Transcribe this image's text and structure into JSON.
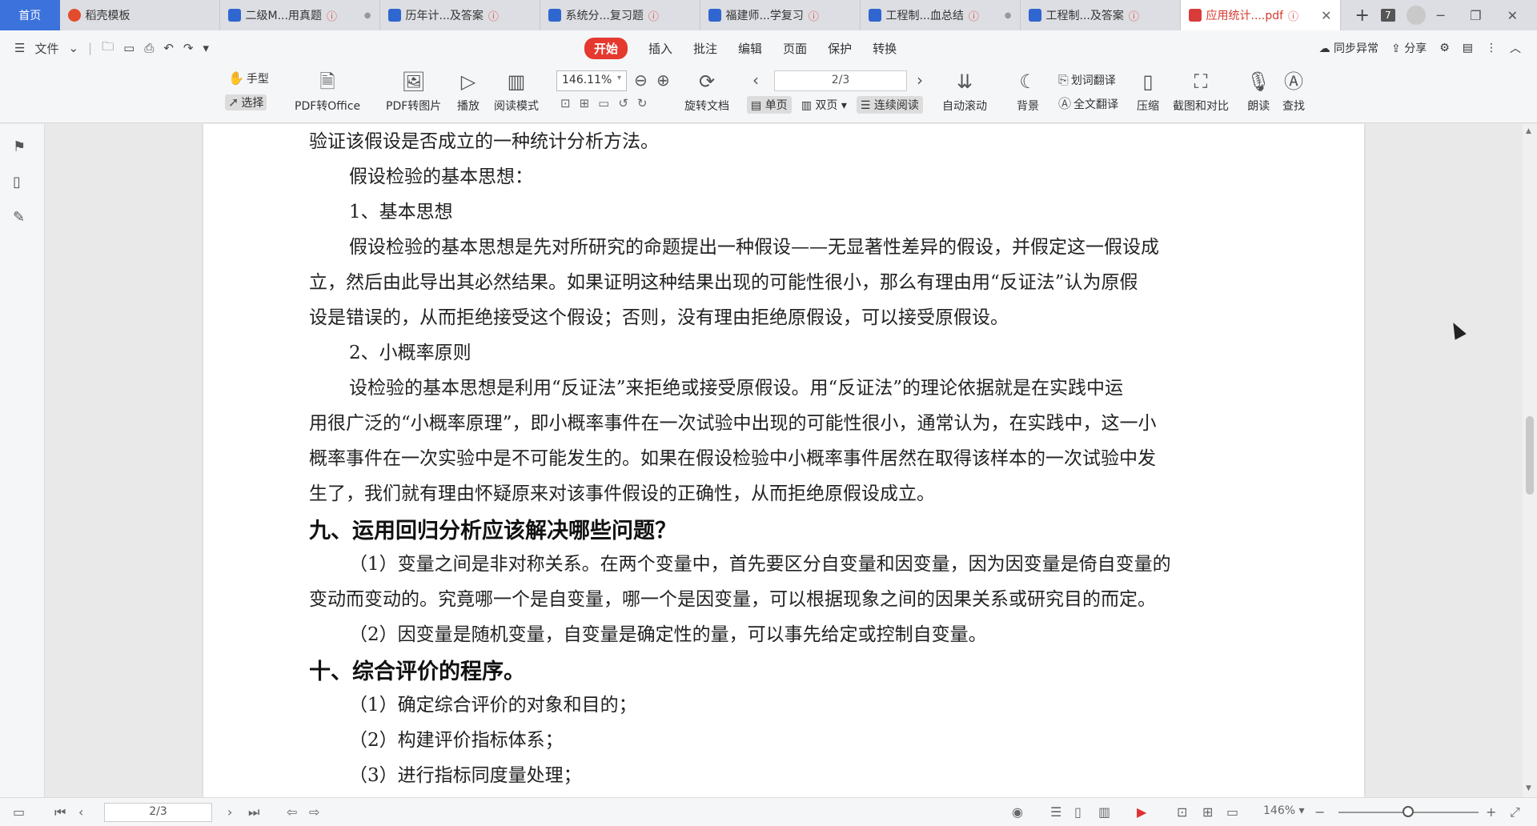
{
  "tabs": {
    "home": "首页",
    "items": [
      {
        "label": "稻壳模板",
        "type": "d"
      },
      {
        "label": "二级M...用真题",
        "type": "w",
        "warn": true,
        "dot": true
      },
      {
        "label": "历年计...及答案",
        "type": "w",
        "warn": true
      },
      {
        "label": "系统分...复习题",
        "type": "w",
        "warn": true
      },
      {
        "label": "福建师...学复习",
        "type": "w",
        "warn": true
      },
      {
        "label": "工程制...血总结",
        "type": "w",
        "warn": true,
        "dot": true
      },
      {
        "label": "工程制...及答案",
        "type": "w",
        "warn": true
      },
      {
        "label": "应用统计....pdf",
        "type": "p",
        "warn": true,
        "active": true
      }
    ],
    "tab_count": "7"
  },
  "menu": {
    "file": "文件",
    "items": [
      "开始",
      "插入",
      "批注",
      "编辑",
      "页面",
      "保护",
      "转换"
    ],
    "sync": "同步异常",
    "share": "分享"
  },
  "toolbar": {
    "hand": "手型",
    "select": "选择",
    "pdf_office": "PDF转Office",
    "pdf_image": "PDF转图片",
    "play": "播放",
    "read_mode": "阅读模式",
    "zoom_value": "146.11%",
    "rotate": "旋转文档",
    "page_value": "2/3",
    "single": "单页",
    "double": "双页",
    "continuous": "连续阅读",
    "autoscroll": "自动滚动",
    "background": "背景",
    "word_translate": "划词翻译",
    "full_translate": "全文翻译",
    "compress": "压缩",
    "screenshot": "截图和对比",
    "read_aloud": "朗读",
    "find": "查找"
  },
  "document": {
    "lines": [
      {
        "text": "验证该假设是否成立的一种统计分析方法。",
        "style": "p"
      },
      {
        "text": "假设检验的基本思想：",
        "style": "in"
      },
      {
        "text": "1、基本思想",
        "style": "in"
      },
      {
        "text": "假设检验的基本思想是先对所研究的命题提出一种假设——无显著性差异的假设，并假定这一假设成",
        "style": "in"
      },
      {
        "text": "立，然后由此导出其必然结果。如果证明这种结果出现的可能性很小，那么有理由用“反证法”认为原假",
        "style": "p"
      },
      {
        "text": "设是错误的，从而拒绝接受这个假设；否则，没有理由拒绝原假设，可以接受原假设。",
        "style": "p"
      },
      {
        "text": "2、小概率原则",
        "style": "in"
      },
      {
        "text": "设检验的基本思想是利用“反证法”来拒绝或接受原假设。用“反证法”的理论依据就是在实践中运",
        "style": "in"
      },
      {
        "text": "用很广泛的“小概率原理”，即小概率事件在一次试验中出现的可能性很小，通常认为，在实践中，这一小",
        "style": "p"
      },
      {
        "text": "概率事件在一次实验中是不可能发生的。如果在假设检验中小概率事件居然在取得该样本的一次试验中发",
        "style": "p"
      },
      {
        "text": "生了，我们就有理由怀疑原来对该事件假设的正确性，从而拒绝原假设成立。",
        "style": "p"
      },
      {
        "text": "九、运用回归分析应该解决哪些问题？",
        "style": "h"
      },
      {
        "text": "（1）变量之间是非对称关系。在两个变量中，首先要区分自变量和因变量，因为因变量是倚自变量的",
        "style": "in"
      },
      {
        "text": "变动而变动的。究竟哪一个是自变量，哪一个是因变量，可以根据现象之间的因果关系或研究目的而定。",
        "style": "p"
      },
      {
        "text": "（2）因变量是随机变量，自变量是确定性的量，可以事先给定或控制自变量。",
        "style": "in"
      },
      {
        "text": "十、综合评价的程序。",
        "style": "h"
      },
      {
        "text": "（1）确定综合评价的对象和目的；",
        "style": "in"
      },
      {
        "text": "（2）构建评价指标体系；",
        "style": "in"
      },
      {
        "text": "（3）进行指标同度量处理；",
        "style": "in"
      }
    ]
  },
  "status": {
    "page_value": "2/3",
    "zoom": "146%"
  },
  "icons": {
    "menu": "hamburger-icon",
    "hand": "hand-icon",
    "select": "cursor-icon"
  },
  "colors": {
    "accent": "#e5392f",
    "home_tab": "#3b72db"
  }
}
